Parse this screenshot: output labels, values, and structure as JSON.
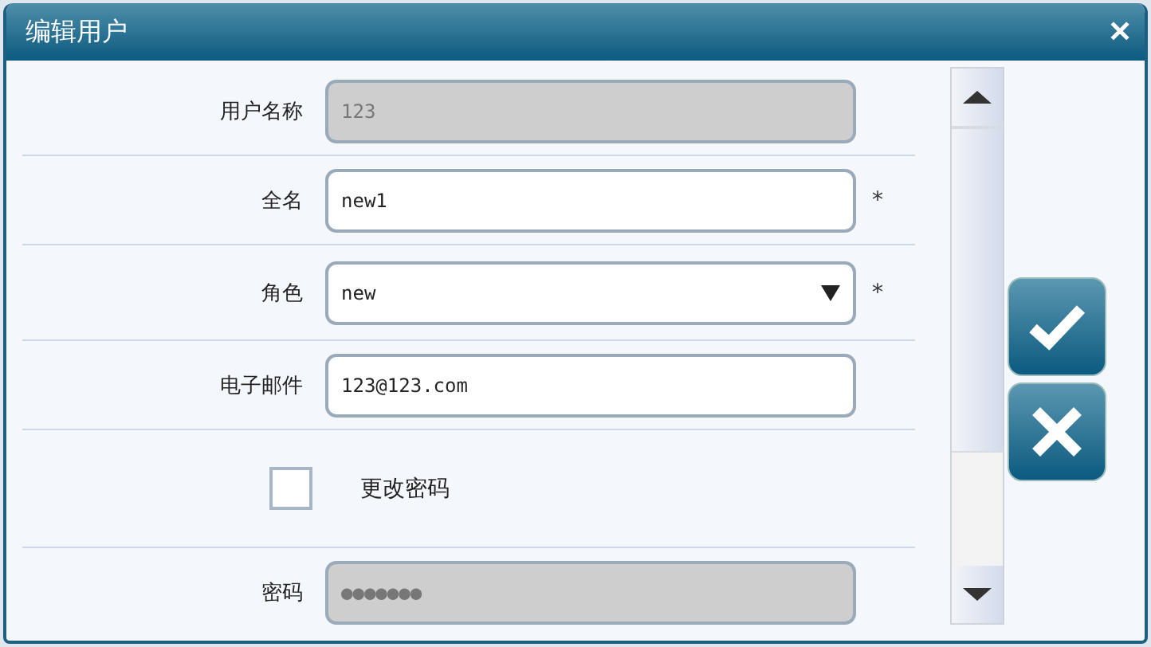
{
  "window": {
    "title": "编辑用户",
    "close": "✕"
  },
  "form": [
    {
      "kind": "text",
      "label": "用户名称",
      "value": "123",
      "disabled": true,
      "required": false
    },
    {
      "kind": "text",
      "label": "全名",
      "value": "new1",
      "disabled": false,
      "required": true
    },
    {
      "kind": "select",
      "label": "角色",
      "value": "new",
      "disabled": false,
      "required": true
    },
    {
      "kind": "text",
      "label": "电子邮件",
      "value": "123@123.com",
      "disabled": false,
      "required": false
    },
    {
      "kind": "checkbox",
      "label": "更改密码",
      "checked": false
    },
    {
      "kind": "text",
      "label": "密码",
      "value": "●●●●●●●",
      "disabled": true,
      "required": false
    }
  ],
  "required_mark": "*"
}
